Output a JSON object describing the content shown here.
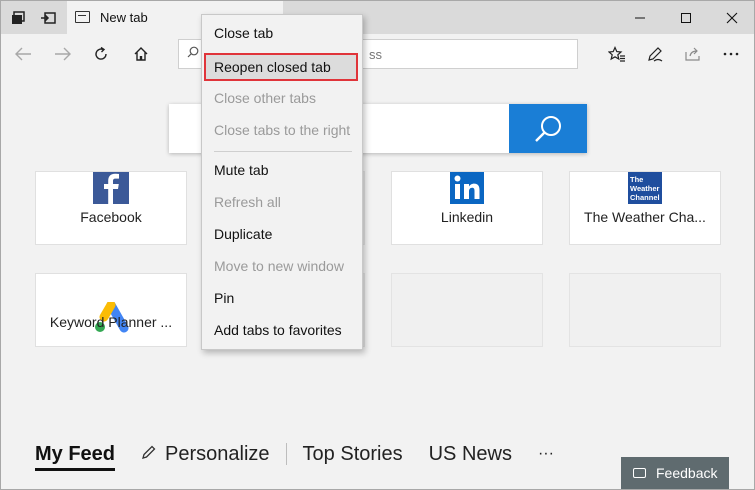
{
  "tab": {
    "title": "New tab"
  },
  "address": {
    "placeholder": "Search or enter web address",
    "placeholder_visible": "ss"
  },
  "tiles": [
    {
      "label": "Facebook",
      "icon": "facebook-icon"
    },
    {
      "label": "Linkedin",
      "icon": "linkedin-icon"
    },
    {
      "label": "The Weather Cha...",
      "icon": "weather-channel-icon",
      "logo_text": [
        "The",
        "Weather",
        "Channel"
      ]
    },
    {
      "label": "Keyword Planner ...",
      "icon": "google-ads-icon"
    }
  ],
  "context_menu": {
    "items": [
      {
        "label": "Close tab",
        "enabled": true
      },
      {
        "label": "Reopen closed tab",
        "enabled": true,
        "selected": true
      },
      {
        "label": "Close other tabs",
        "enabled": false
      },
      {
        "label": "Close tabs to the right",
        "enabled": false
      },
      {
        "label": "Mute tab",
        "enabled": true
      },
      {
        "label": "Refresh all",
        "enabled": false
      },
      {
        "label": "Duplicate",
        "enabled": true
      },
      {
        "label": "Move to new window",
        "enabled": false
      },
      {
        "label": "Pin",
        "enabled": true
      },
      {
        "label": "Add tabs to favorites",
        "enabled": true
      }
    ]
  },
  "feed": {
    "tabs": [
      "My Feed",
      "Personalize",
      "Top Stories",
      "US News"
    ],
    "more": "···"
  },
  "feedback": {
    "label": "Feedback"
  },
  "colors": {
    "accent": "#1a7ed6",
    "highlight_border": "#e0343a",
    "facebook": "#3b5998",
    "linkedin": "#0a66c2"
  }
}
